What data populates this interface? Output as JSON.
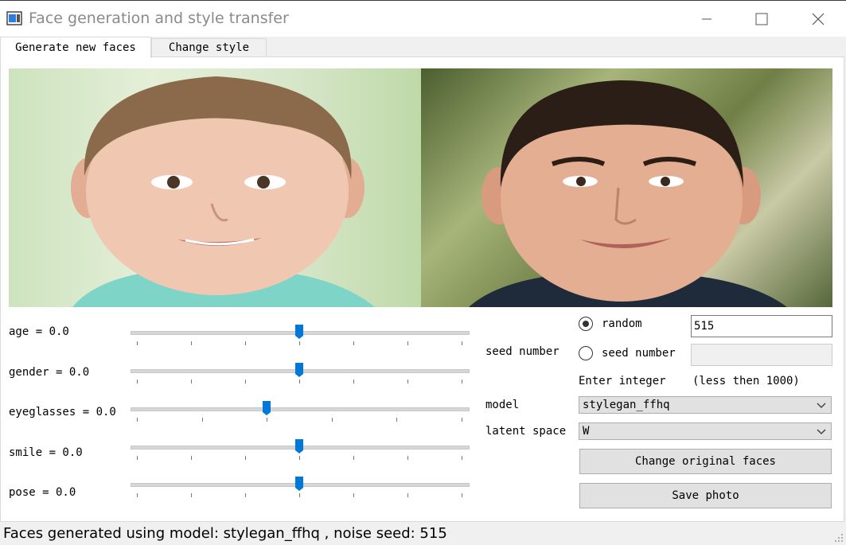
{
  "window": {
    "title": "Face generation and style transfer"
  },
  "tabs": [
    {
      "label": "Generate new faces",
      "active": true
    },
    {
      "label": "Change style",
      "active": false
    }
  ],
  "sliders": [
    {
      "label": "age = 0.0",
      "value": 0.0,
      "position": 0.5
    },
    {
      "label": "gender = 0.0",
      "value": 0.0,
      "position": 0.5
    },
    {
      "label": "eyeglasses = 0.0",
      "value": 0.0,
      "position": 0.4
    },
    {
      "label": "smile = 0.0",
      "value": 0.0,
      "position": 0.5
    },
    {
      "label": "pose = 0.0",
      "value": 0.0,
      "position": 0.5
    }
  ],
  "seed": {
    "label": "seed number",
    "random_label": "random",
    "random_selected": true,
    "random_value": "515",
    "manual_label": "seed number",
    "manual_value": "",
    "hint_left": "Enter integer",
    "hint_right": "(less then 1000)"
  },
  "model": {
    "label": "model",
    "selected": "stylegan_ffhq"
  },
  "latent": {
    "label": "latent space",
    "selected": "W"
  },
  "buttons": {
    "change_faces": "Change original faces",
    "save_photo": "Save photo"
  },
  "status": {
    "text": "Faces generated using model: stylegan_ffhq , noise seed: 515"
  },
  "colors": {
    "accent": "#0078d7",
    "panel": "#ffffff",
    "window_bg": "#f0f0f0"
  }
}
